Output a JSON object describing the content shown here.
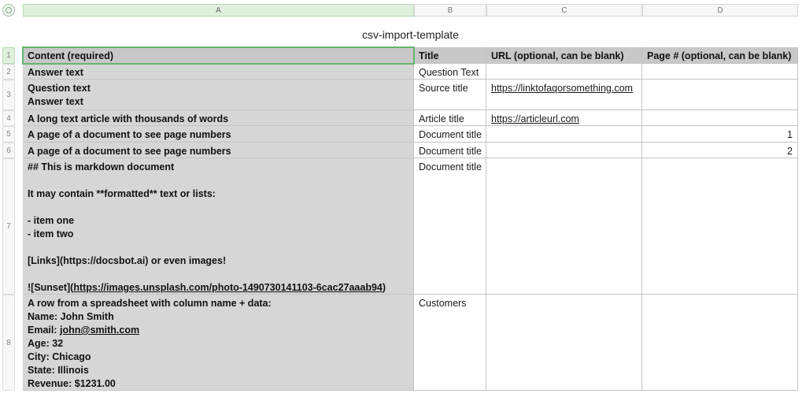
{
  "columns": [
    "A",
    "B",
    "C",
    "D"
  ],
  "title": "csv-import-template",
  "header": {
    "a": "Content (required)",
    "b": "Title",
    "c": "URL (optional, can be blank)",
    "d": "Page # (optional, can be blank)"
  },
  "rows": [
    {
      "num": "2",
      "a": [
        "Answer text"
      ],
      "b": "Question Text",
      "c": "",
      "d": ""
    },
    {
      "num": "3",
      "a": [
        "Question text",
        "Answer text"
      ],
      "b": "Source title",
      "c": "https://linktofaqorsomething.com",
      "d": ""
    },
    {
      "num": "4",
      "a": [
        "A long text article with thousands of words"
      ],
      "b": "Article title",
      "c": "https://articleurl.com",
      "d": ""
    },
    {
      "num": "5",
      "a": [
        "A page of a document to see page numbers"
      ],
      "b": "Document title",
      "c": "",
      "d": "1"
    },
    {
      "num": "6",
      "a": [
        "A page of a document to see page numbers"
      ],
      "b": "Document title",
      "c": "",
      "d": "2"
    },
    {
      "num": "7",
      "a": [
        "## This is markdown document",
        "",
        "It may contain **formatted** text or lists:",
        "",
        "- item one",
        "- item two",
        "",
        "[Links](https://docsbot.ai) or even images!",
        "",
        "![Sunset](https://images.unsplash.com/photo-1490730141103-6cac27aaab94)"
      ],
      "b": "Document title",
      "c": "",
      "d": ""
    },
    {
      "num": "8",
      "a": [
        "A row from a spreadsheet with column name + data:",
        "Name: John Smith",
        "Email: john@smith.com",
        "Age: 32",
        "City: Chicago",
        "State: Illinois",
        "Revenue: $1231.00"
      ],
      "b": "Customers",
      "c": "",
      "d": ""
    }
  ],
  "header_row_num": "1",
  "colors": {
    "selection": "#66b56b",
    "header_bg": "#c8c8c8",
    "content_bg": "#d6d6d6"
  }
}
